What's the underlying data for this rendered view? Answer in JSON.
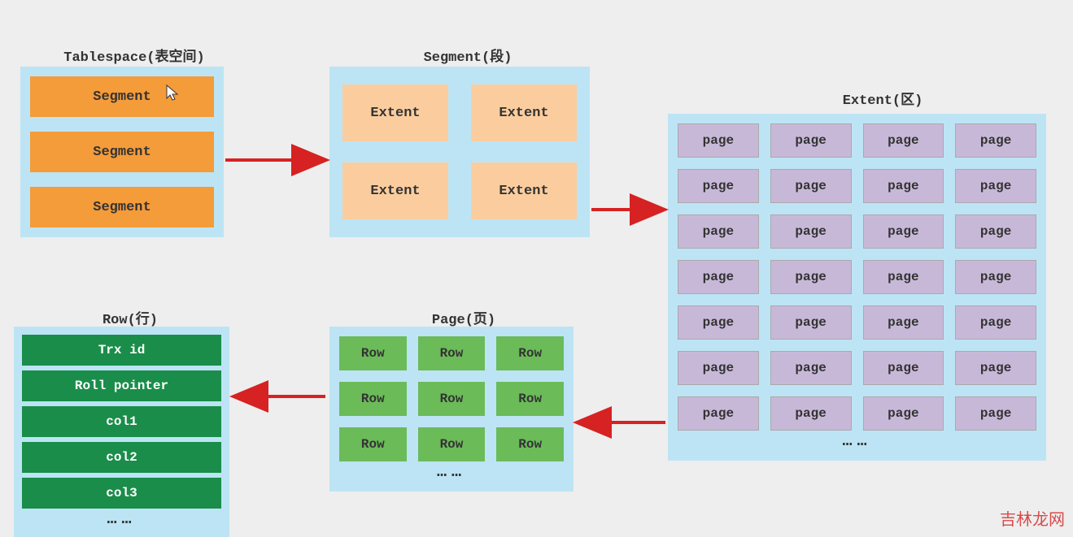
{
  "tablespace": {
    "title": "Tablespace(表空间)",
    "items": [
      "Segment",
      "Segment",
      "Segment"
    ]
  },
  "segment": {
    "title": "Segment(段)",
    "items": [
      "Extent",
      "Extent",
      "Extent",
      "Extent"
    ]
  },
  "extent": {
    "title": "Extent(区)",
    "page_label": "page",
    "rows": 7,
    "cols": 4,
    "ellipsis": "……"
  },
  "page": {
    "title": "Page(页)",
    "row_label": "Row",
    "rows": 3,
    "cols": 3,
    "ellipsis": "……"
  },
  "row": {
    "title": "Row(行)",
    "fields": [
      "Trx id",
      "Roll pointer",
      "col1",
      "col2",
      "col3"
    ],
    "ellipsis": "……"
  },
  "watermark": "吉林龙网",
  "colors": {
    "bg": "#eeeeee",
    "panel": "#bde4f4",
    "segment": "#f49b3a",
    "extent": "#fbcd9e",
    "page": "#c8b8d8",
    "row": "#6bbb59",
    "field": "#1a8d4a",
    "arrow": "#d62222"
  }
}
